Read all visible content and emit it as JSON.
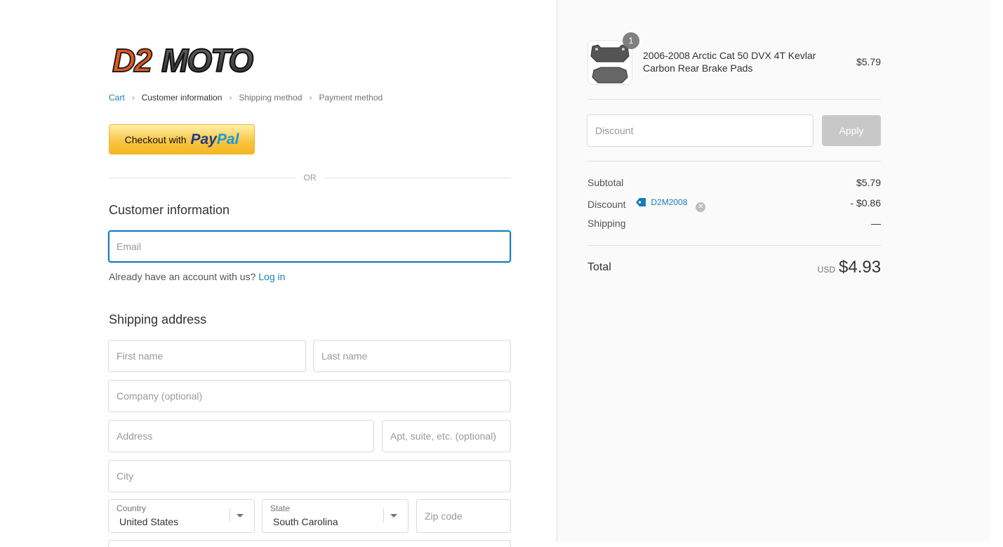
{
  "brand": {
    "logo_text": "D2MOTO",
    "accent": "#e8581c"
  },
  "breadcrumb": {
    "items": [
      {
        "label": "Cart",
        "state": "link"
      },
      {
        "label": "Customer information",
        "state": "active"
      },
      {
        "label": "Shipping method",
        "state": "inactive"
      },
      {
        "label": "Payment method",
        "state": "inactive"
      }
    ]
  },
  "paypal": {
    "prefix": "Checkout with",
    "pay": "Pay",
    "pal": "Pal"
  },
  "divider": {
    "label": "OR"
  },
  "customer": {
    "heading": "Customer information",
    "email_placeholder": "Email",
    "account_prompt": "Already have an account with us?",
    "login_label": "Log in"
  },
  "shipping": {
    "heading": "Shipping address",
    "first_name_placeholder": "First name",
    "last_name_placeholder": "Last name",
    "company_placeholder": "Company (optional)",
    "address_placeholder": "Address",
    "apt_placeholder": "Apt, suite, etc. (optional)",
    "city_placeholder": "City",
    "country_label": "Country",
    "country_value": "United States",
    "state_label": "State",
    "state_value": "South Carolina",
    "zip_placeholder": "Zip code"
  },
  "order": {
    "product": {
      "quantity": "1",
      "name": "2006-2008 Arctic Cat 50 DVX 4T Kevlar Carbon Rear Brake Pads",
      "price": "$5.79"
    },
    "discount_placeholder": "Discount",
    "apply_label": "Apply",
    "subtotal_label": "Subtotal",
    "subtotal_value": "$5.79",
    "discount_label": "Discount",
    "discount_code": "D2M2008",
    "discount_value": "- $0.86",
    "shipping_label": "Shipping",
    "shipping_value": "—",
    "total_label": "Total",
    "total_currency": "USD",
    "total_value": "$4.93"
  }
}
